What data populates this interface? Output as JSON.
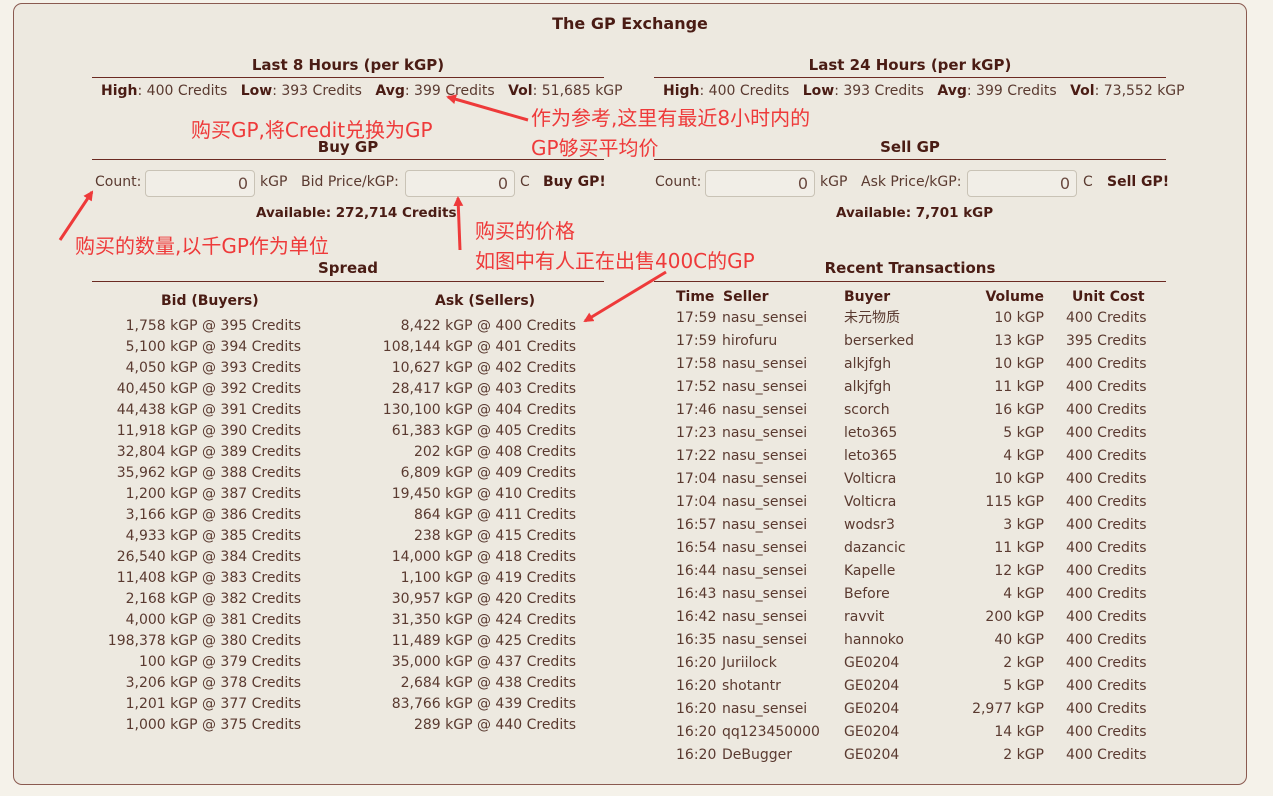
{
  "page_title": "The GP Exchange",
  "last8": {
    "title": "Last 8 Hours (per kGP)",
    "high_label": "High",
    "high": ": 400 Credits",
    "low_label": "Low",
    "low": ": 393 Credits",
    "avg_label": "Avg",
    "avg": ": 399 Credits",
    "vol_label": "Vol",
    "vol": ": 51,685 kGP"
  },
  "last24": {
    "title": "Last 24 Hours (per kGP)",
    "high_label": "High",
    "high": ": 400 Credits",
    "low_label": "Low",
    "low": ": 393 Credits",
    "avg_label": "Avg",
    "avg": ": 399 Credits",
    "vol_label": "Vol",
    "vol": ": 73,552 kGP"
  },
  "buy": {
    "title": "Buy GP",
    "count_label": "Count:",
    "count_value": "0",
    "count_unit": "kGP",
    "price_label": "Bid Price/kGP:",
    "price_value": "0",
    "price_unit": "C",
    "button": "Buy GP!",
    "available": "Available: 272,714 Credits"
  },
  "sell": {
    "title": "Sell GP",
    "count_label": "Count:",
    "count_value": "0",
    "count_unit": "kGP",
    "price_label": "Ask Price/kGP:",
    "price_value": "0",
    "price_unit": "C",
    "button": "Sell GP!",
    "available": "Available: 7,701 kGP"
  },
  "spread": {
    "title": "Spread",
    "bid_header": "Bid (Buyers)",
    "ask_header": "Ask (Sellers)",
    "bids": [
      "1,758 kGP @ 395 Credits",
      "5,100 kGP @ 394 Credits",
      "4,050 kGP @ 393 Credits",
      "40,450 kGP @ 392 Credits",
      "44,438 kGP @ 391 Credits",
      "11,918 kGP @ 390 Credits",
      "32,804 kGP @ 389 Credits",
      "35,962 kGP @ 388 Credits",
      "1,200 kGP @ 387 Credits",
      "3,166 kGP @ 386 Credits",
      "4,933 kGP @ 385 Credits",
      "26,540 kGP @ 384 Credits",
      "11,408 kGP @ 383 Credits",
      "2,168 kGP @ 382 Credits",
      "4,000 kGP @ 381 Credits",
      "198,378 kGP @ 380 Credits",
      "100 kGP @ 379 Credits",
      "3,206 kGP @ 378 Credits",
      "1,201 kGP @ 377 Credits",
      "1,000 kGP @ 375 Credits"
    ],
    "asks": [
      "8,422 kGP @ 400 Credits",
      "108,144 kGP @ 401 Credits",
      "10,627 kGP @ 402 Credits",
      "28,417 kGP @ 403 Credits",
      "130,100 kGP @ 404 Credits",
      "61,383 kGP @ 405 Credits",
      "202 kGP @ 408 Credits",
      "6,809 kGP @ 409 Credits",
      "19,450 kGP @ 410 Credits",
      "864 kGP @ 411 Credits",
      "238 kGP @ 415 Credits",
      "14,000 kGP @ 418 Credits",
      "1,100 kGP @ 419 Credits",
      "30,957 kGP @ 420 Credits",
      "31,350 kGP @ 424 Credits",
      "11,489 kGP @ 425 Credits",
      "35,000 kGP @ 437 Credits",
      "2,684 kGP @ 438 Credits",
      "83,766 kGP @ 439 Credits",
      "289 kGP @ 440 Credits"
    ]
  },
  "transactions": {
    "title": "Recent Transactions",
    "headers": {
      "time": "Time",
      "seller": "Seller",
      "buyer": "Buyer",
      "volume": "Volume",
      "cost": "Unit Cost"
    },
    "rows": [
      {
        "time": "17:59",
        "seller": "nasu_sensei",
        "buyer": "未元物质",
        "volume": "10 kGP",
        "cost": "400 Credits"
      },
      {
        "time": "17:59",
        "seller": "hirofuru",
        "buyer": "berserked",
        "volume": "13 kGP",
        "cost": "395 Credits"
      },
      {
        "time": "17:58",
        "seller": "nasu_sensei",
        "buyer": "alkjfgh",
        "volume": "10 kGP",
        "cost": "400 Credits"
      },
      {
        "time": "17:52",
        "seller": "nasu_sensei",
        "buyer": "alkjfgh",
        "volume": "11 kGP",
        "cost": "400 Credits"
      },
      {
        "time": "17:46",
        "seller": "nasu_sensei",
        "buyer": "scorch",
        "volume": "16 kGP",
        "cost": "400 Credits"
      },
      {
        "time": "17:23",
        "seller": "nasu_sensei",
        "buyer": "leto365",
        "volume": "5 kGP",
        "cost": "400 Credits"
      },
      {
        "time": "17:22",
        "seller": "nasu_sensei",
        "buyer": "leto365",
        "volume": "4 kGP",
        "cost": "400 Credits"
      },
      {
        "time": "17:04",
        "seller": "nasu_sensei",
        "buyer": "Volticra",
        "volume": "10 kGP",
        "cost": "400 Credits"
      },
      {
        "time": "17:04",
        "seller": "nasu_sensei",
        "buyer": "Volticra",
        "volume": "115 kGP",
        "cost": "400 Credits"
      },
      {
        "time": "16:57",
        "seller": "nasu_sensei",
        "buyer": "wodsr3",
        "volume": "3 kGP",
        "cost": "400 Credits"
      },
      {
        "time": "16:54",
        "seller": "nasu_sensei",
        "buyer": "dazancic",
        "volume": "11 kGP",
        "cost": "400 Credits"
      },
      {
        "time": "16:44",
        "seller": "nasu_sensei",
        "buyer": "Kapelle",
        "volume": "12 kGP",
        "cost": "400 Credits"
      },
      {
        "time": "16:43",
        "seller": "nasu_sensei",
        "buyer": "Before",
        "volume": "4 kGP",
        "cost": "400 Credits"
      },
      {
        "time": "16:42",
        "seller": "nasu_sensei",
        "buyer": "ravvit",
        "volume": "200 kGP",
        "cost": "400 Credits"
      },
      {
        "time": "16:35",
        "seller": "nasu_sensei",
        "buyer": "hannoko",
        "volume": "40 kGP",
        "cost": "400 Credits"
      },
      {
        "time": "16:20",
        "seller": "Juriilock",
        "buyer": "GE0204",
        "volume": "2 kGP",
        "cost": "400 Credits"
      },
      {
        "time": "16:20",
        "seller": "shotantr",
        "buyer": "GE0204",
        "volume": "5 kGP",
        "cost": "400 Credits"
      },
      {
        "time": "16:20",
        "seller": "nasu_sensei",
        "buyer": "GE0204",
        "volume": "2,977 kGP",
        "cost": "400 Credits"
      },
      {
        "time": "16:20",
        "seller": "qq123450000",
        "buyer": "GE0204",
        "volume": "14 kGP",
        "cost": "400 Credits"
      },
      {
        "time": "16:20",
        "seller": "DeBugger",
        "buyer": "GE0204",
        "volume": "2 kGP",
        "cost": "400 Credits"
      }
    ]
  },
  "annotations": {
    "color": "#ee3a3a",
    "buy_hint": "购买GP,将Credit兑换为GP",
    "avg_hint_1": "作为参考,这里有最近8小时内的",
    "avg_hint_2": "GP够买平均价",
    "count_hint": "购买的数量,以千GP作为单位",
    "price_hint_1": "购买的价格",
    "price_hint_2": "如图中有人正在出售400C的GP"
  }
}
